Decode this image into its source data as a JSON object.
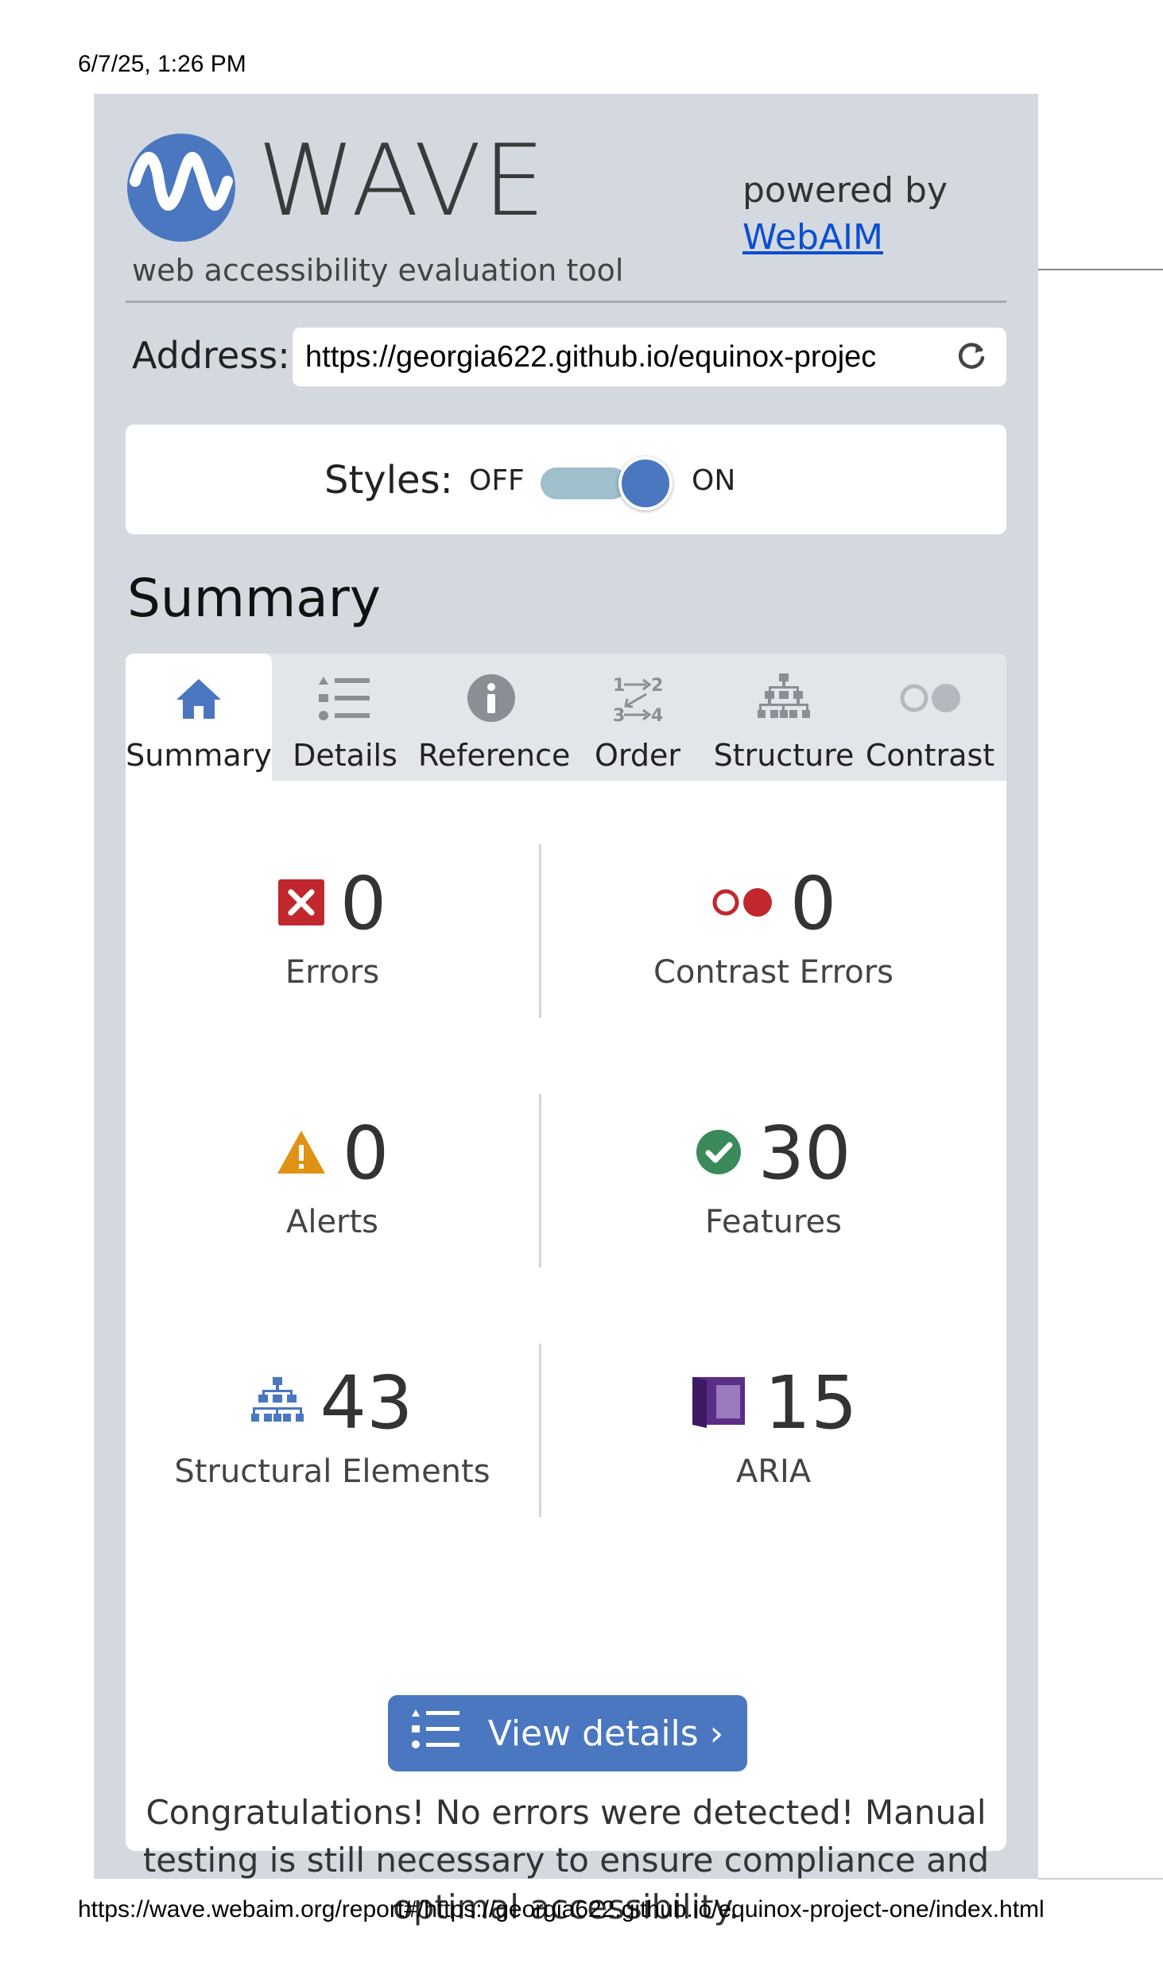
{
  "print": {
    "timestamp": "6/7/25, 1:26 PM",
    "footer_url": "https://wave.webaim.org/report#/https://georgia622.github.io/equinox-project-one/index.html"
  },
  "header": {
    "logo_word": "WAVE",
    "logo_subtitle": "web accessibility evaluation tool",
    "powered_by": "powered by",
    "webaim_link": "WebAIM"
  },
  "address": {
    "label": "Address:",
    "value": "https://georgia622.github.io/equinox-projec"
  },
  "styles_toggle": {
    "label": "Styles:",
    "off_label": "OFF",
    "on_label": "ON",
    "state": "on"
  },
  "summary_heading": "Summary",
  "tabs": [
    {
      "label": "Summary",
      "icon": "home-icon",
      "active": true
    },
    {
      "label": "Details",
      "icon": "list-icon",
      "active": false
    },
    {
      "label": "Reference",
      "icon": "info-icon",
      "active": false
    },
    {
      "label": "Order",
      "icon": "order-icon",
      "active": false
    },
    {
      "label": "Structure",
      "icon": "structure-icon",
      "active": false
    },
    {
      "label": "Contrast",
      "icon": "contrast-icon",
      "active": false
    }
  ],
  "stats": {
    "errors": {
      "value": "0",
      "label": "Errors",
      "icon": "error-icon"
    },
    "contrast_errors": {
      "value": "0",
      "label": "Contrast Errors",
      "icon": "contrast-error-icon"
    },
    "alerts": {
      "value": "0",
      "label": "Alerts",
      "icon": "alert-icon"
    },
    "features": {
      "value": "30",
      "label": "Features",
      "icon": "feature-check-icon"
    },
    "structural": {
      "value": "43",
      "label": "Structural Elements",
      "icon": "structure-icon"
    },
    "aria": {
      "value": "15",
      "label": "ARIA",
      "icon": "aria-icon"
    }
  },
  "view_details_label": "View details ›",
  "congrats_message": "Congratulations! No errors were detected! Manual testing is still necessary to ensure compliance and optimal accessibility.",
  "colors": {
    "panel_bg": "#d4d9e0",
    "accent_blue": "#4a77c0",
    "error_red": "#c0282d",
    "alert_orange": "#e09214",
    "feature_green": "#3a8a5a",
    "aria_purple": "#5a2d86",
    "link_blue": "#0b4fd0"
  }
}
